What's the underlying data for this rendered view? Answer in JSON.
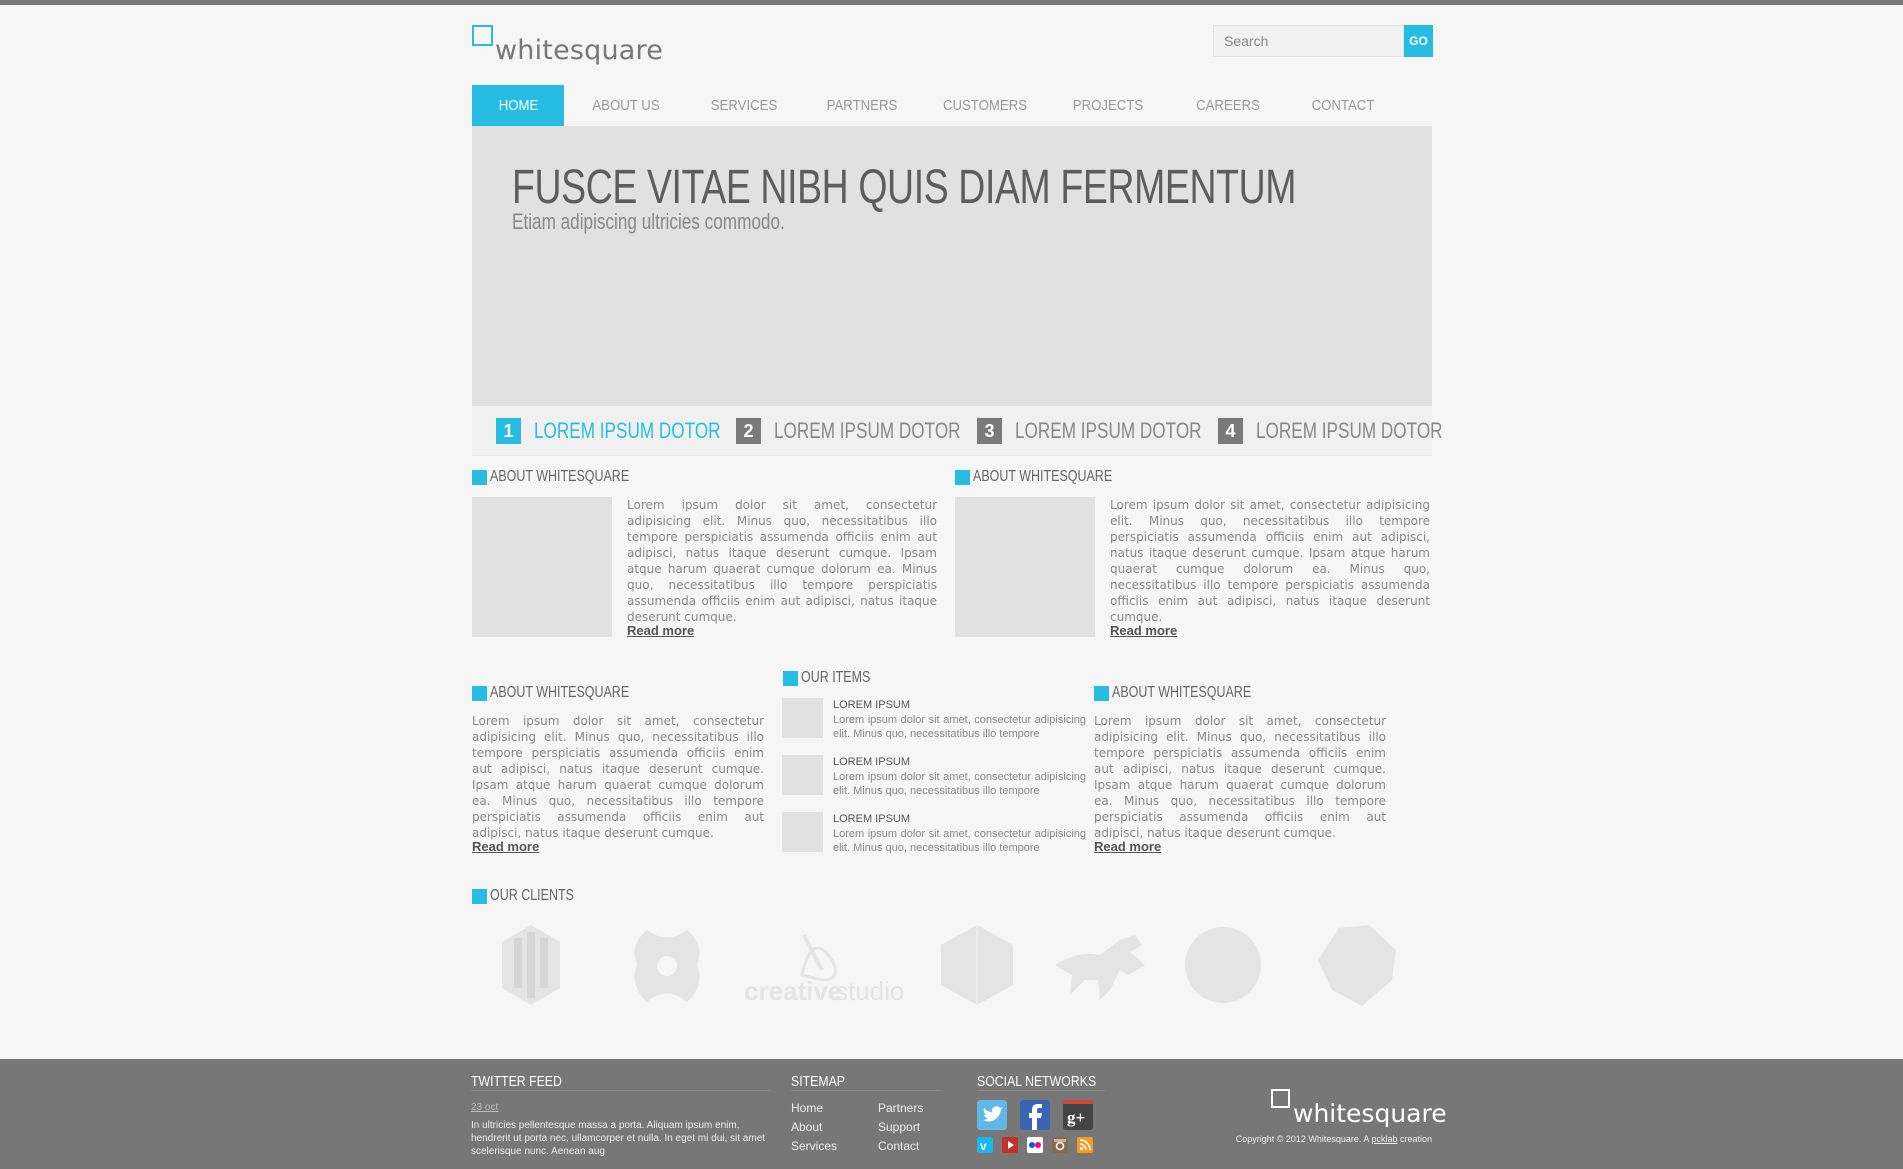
{
  "brand": {
    "name": "whitesquare",
    "accent": "#27bde2"
  },
  "search": {
    "placeholder": "Search",
    "button": "GO"
  },
  "nav": [
    "HOME",
    "ABOUT US",
    "SERVICES",
    "PARTNERS",
    "CUSTOMERS",
    "PROJECTS",
    "CAREERS",
    "CONTACT"
  ],
  "hero": {
    "title": "FUSCE VITAE NIBH QUIS DIAM FERMENTUM",
    "subtitle": "Etiam adipiscing ultricies commodo."
  },
  "slider_tabs": [
    {
      "num": "1",
      "label": "LOREM IPSUM DOTOR"
    },
    {
      "num": "2",
      "label": "LOREM IPSUM DOTOR"
    },
    {
      "num": "3",
      "label": "LOREM IPSUM DOTOR"
    },
    {
      "num": "4",
      "label": "LOREM IPSUM DOTOR"
    }
  ],
  "about_left": {
    "title": "ABOUT WHITESQUARE",
    "text": "Lorem ipsum dolor sit amet, consectetur adipisicing elit. Minus quo, necessitatibus illo tempore perspiciatis assumenda officiis enim aut adipisci, natus itaque deserunt cumque. Ipsam atque harum quaerat cumque dolorum ea. Minus quo, necessitatibus illo tempore perspiciatis assumenda officiis enim aut adipisci, natus itaque deserunt cumque.",
    "read_more": "Read more"
  },
  "about_right": {
    "title": "ABOUT WHITESQUARE",
    "text": "Lorem ipsum dolor sit amet, consectetur adipisicing elit. Minus quo, necessitatibus illo tempore perspiciatis assumenda officiis enim aut adipisci, natus itaque deserunt cumque. Ipsam atque harum quaerat cumque dolorum ea. Minus quo, necessitatibus illo tempore perspiciatis assumenda officiis enim aut adipisci, natus itaque deserunt cumque.",
    "read_more": "Read more"
  },
  "col1": {
    "title": "ABOUT WHITESQUARE",
    "text": "Lorem ipsum dolor sit amet, consectetur adipisicing elit. Minus quo, necessitatibus illo tempore perspiciatis assumenda officiis enim aut adipisci, natus itaque deserunt cumque. Ipsam atque harum quaerat cumque dolorum ea. Minus quo, necessitatibus illo tempore perspiciatis assumenda officiis enim aut adipisci, natus itaque deserunt cumque.",
    "read_more": "Read more"
  },
  "items": {
    "title": "OUR ITEMS",
    "list": [
      {
        "title": "LOREM IPSUM",
        "text": "Lorem ipsum dolor sit amet, consectetur adipisicing elit. Minus quo, necessitatibus illo tempore"
      },
      {
        "title": "LOREM IPSUM",
        "text": "Lorem ipsum dolor sit amet, consectetur adipisicing elit. Minus quo, necessitatibus illo tempore"
      },
      {
        "title": "LOREM IPSUM",
        "text": "Lorem ipsum dolor sit amet, consectetur adipisicing elit. Minus quo, necessitatibus illo tempore"
      }
    ]
  },
  "col3": {
    "title": "ABOUT WHITESQUARE",
    "text": "Lorem ipsum dolor sit amet, consectetur adipisicing elit. Minus quo, necessitatibus illo tempore perspiciatis assumenda officiis enim aut adipisci, natus itaque deserunt cumque. Ipsam atque harum quaerat cumque dolorum ea. Minus quo, necessitatibus illo tempore perspiciatis assumenda officiis enim aut adipisci, natus itaque deserunt cumque.",
    "read_more": "Read more"
  },
  "clients": {
    "title": "OUR CLIENTS",
    "logos": [
      "hexagon-logo",
      "knot-logo",
      "creativestudio",
      "cube-logo",
      "horse-logo",
      "circle-logo",
      "shape-logo"
    ],
    "creative_a": "creative",
    "creative_b": "studio"
  },
  "footer": {
    "twitter_title": "TWITTER FEED",
    "tweet_date": "23 oct",
    "tweet_text": "In ultricies pellentesque massa a porta. Aliquam ipsum enim, hendrerit ut porta nec, ullamcorper et nulla. In eget mi dui, sit amet scelerisque nunc. Aenean aug",
    "sitemap_title": "SITEMAP",
    "sitemap_col1": [
      "Home",
      "About",
      "Services"
    ],
    "sitemap_col2": [
      "Partners",
      "Support",
      "Contact"
    ],
    "social_title": "SOCIAL NETWORKS",
    "social_big": [
      "twitter",
      "facebook",
      "google-plus"
    ],
    "social_small": [
      "vimeo",
      "youtube",
      "flickr",
      "instagram",
      "rss"
    ],
    "logo_text": "whitesquare",
    "copyright_pre": "Copyright © 2012 Whitesquare. A ",
    "copyright_link": "pcklab",
    "copyright_post": " creation"
  }
}
